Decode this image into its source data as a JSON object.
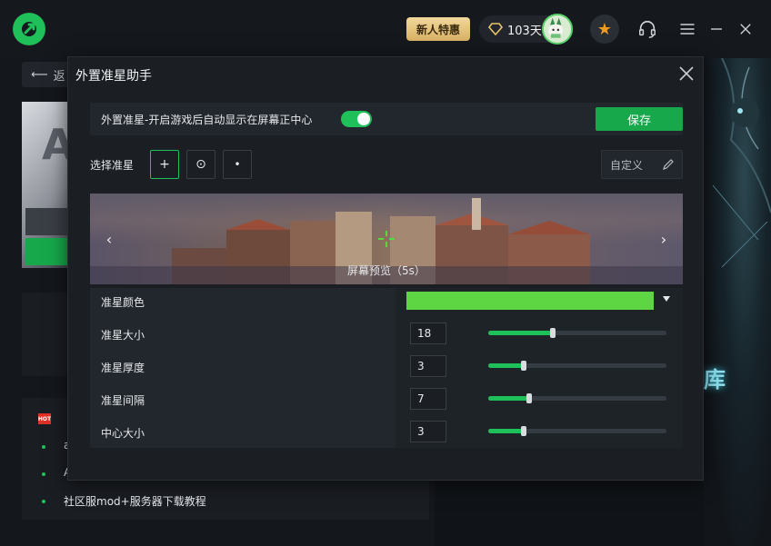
{
  "topbar": {
    "promo_label": "新人特惠",
    "vip_days": "103天"
  },
  "background": {
    "back_label": "返",
    "game_letter": "A",
    "hot_tag": "HOT",
    "hot_items": [
      "a",
      "A",
      "社区服mod+服务器下载教程"
    ],
    "right_text": "库"
  },
  "modal": {
    "title": "外置准星助手",
    "toggle_label": "外置准星-开启游戏后自动显示在屏幕正中心",
    "toggle_on": true,
    "save_label": "保存",
    "select_label": "选择准星",
    "crosshair_options": [
      {
        "glyph": "+",
        "selected": true
      },
      {
        "glyph": "⊙",
        "selected": false
      },
      {
        "glyph": "•",
        "selected": false
      }
    ],
    "custom_label": "自定义",
    "preview_caption": "屏幕预览（5s）",
    "settings": {
      "color_label": "准星颜色",
      "color_value": "#5ed543",
      "size_label": "准星大小",
      "size_value": "18",
      "thickness_label": "准星厚度",
      "thickness_value": "3",
      "gap_label": "准星间隔",
      "gap_value": "7",
      "center_label": "中心大小",
      "center_value": "3"
    },
    "slider_levels": {
      "size": 0.36,
      "thickness": 0.2,
      "gap": 0.23,
      "center": 0.2
    }
  },
  "colors": {
    "accent": "#1fbf5a",
    "save_button": "#17a84b",
    "crosshair_color": "#5ed543"
  }
}
